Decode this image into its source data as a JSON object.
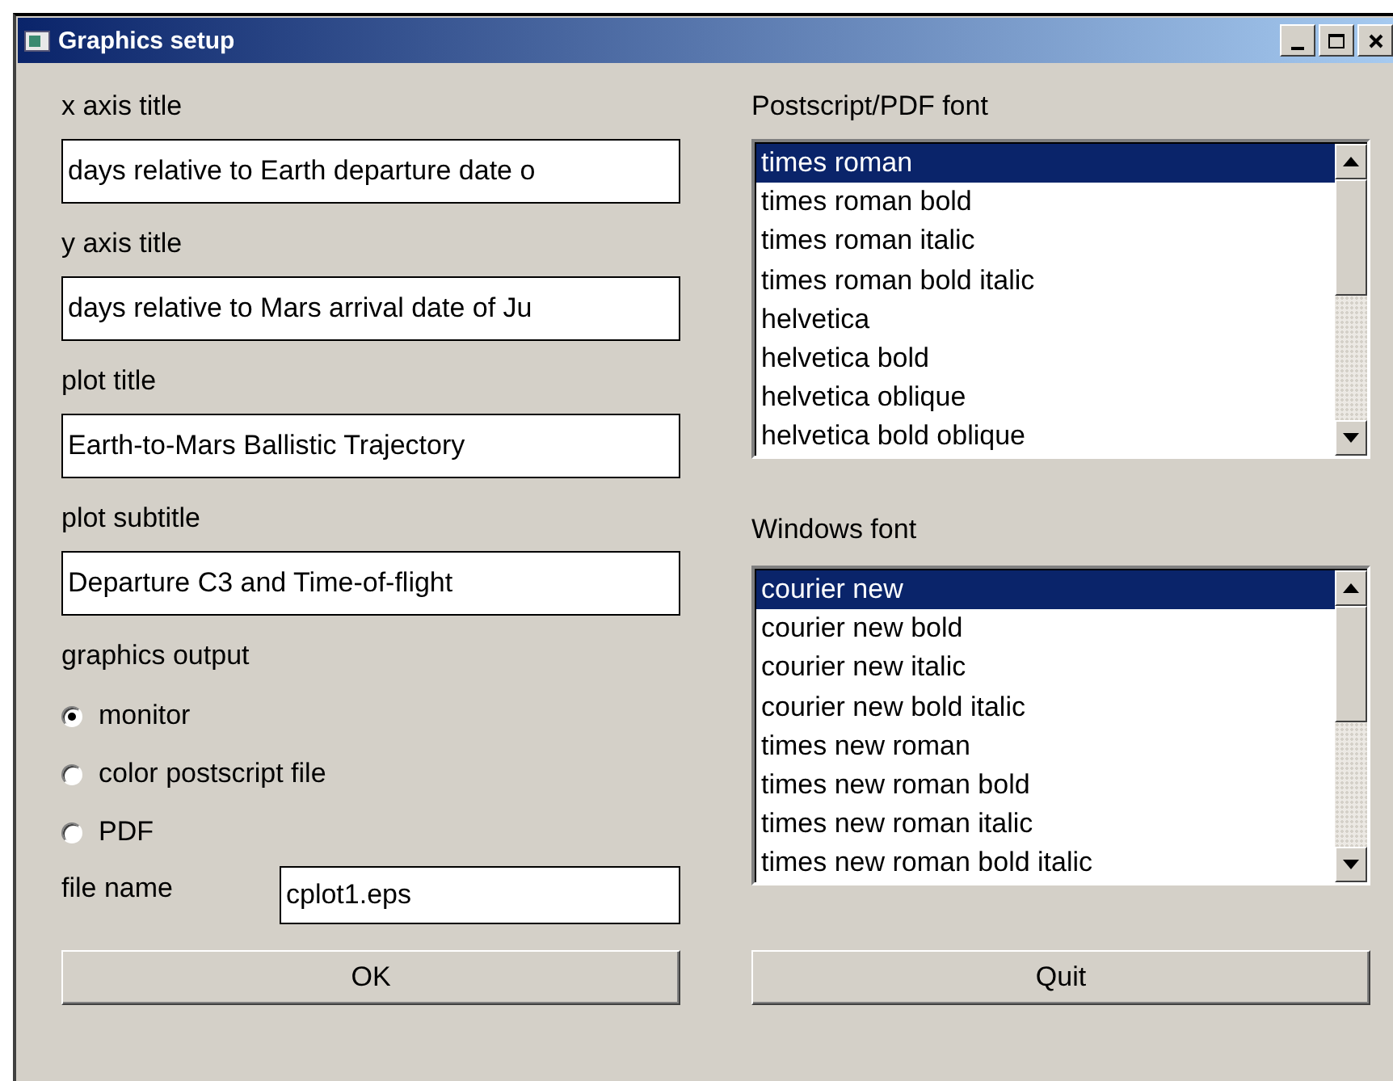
{
  "window": {
    "title": "Graphics setup"
  },
  "fields": [
    {
      "label": "x axis title",
      "value": "days relative to Earth departure date o"
    },
    {
      "label": "y axis title",
      "value": "days relative to Mars arrival date of Ju"
    },
    {
      "label": "plot title",
      "value": "Earth-to-Mars Ballistic Trajectory"
    },
    {
      "label": "plot subtitle",
      "value": "Departure C3 and Time-of-flight"
    }
  ],
  "graphics_output": {
    "label": "graphics output",
    "options": [
      {
        "label": "monitor",
        "selected": true
      },
      {
        "label": "color postscript file",
        "selected": false
      },
      {
        "label": "PDF",
        "selected": false
      }
    ]
  },
  "file_name": {
    "label": "file name",
    "value": "cplot1.eps"
  },
  "lists": [
    {
      "label": "Postscript/PDF font",
      "items": [
        {
          "label": "times roman",
          "selected": true
        },
        {
          "label": "times roman bold",
          "selected": false
        },
        {
          "label": "times roman italic",
          "selected": false
        },
        {
          "label": "times roman bold italic",
          "selected": false
        },
        {
          "label": "helvetica",
          "selected": false
        },
        {
          "label": "helvetica bold",
          "selected": false
        },
        {
          "label": "helvetica oblique",
          "selected": false
        },
        {
          "label": "helvetica bold oblique",
          "selected": false
        }
      ]
    },
    {
      "label": "Windows font",
      "items": [
        {
          "label": "courier new",
          "selected": true
        },
        {
          "label": "courier new bold",
          "selected": false
        },
        {
          "label": "courier new italic",
          "selected": false
        },
        {
          "label": "courier new bold italic",
          "selected": false
        },
        {
          "label": "times new roman",
          "selected": false
        },
        {
          "label": "times new roman bold",
          "selected": false
        },
        {
          "label": "times new roman italic",
          "selected": false
        },
        {
          "label": "times new roman bold italic",
          "selected": false
        }
      ]
    }
  ],
  "buttons": [
    "OK",
    "Quit"
  ]
}
